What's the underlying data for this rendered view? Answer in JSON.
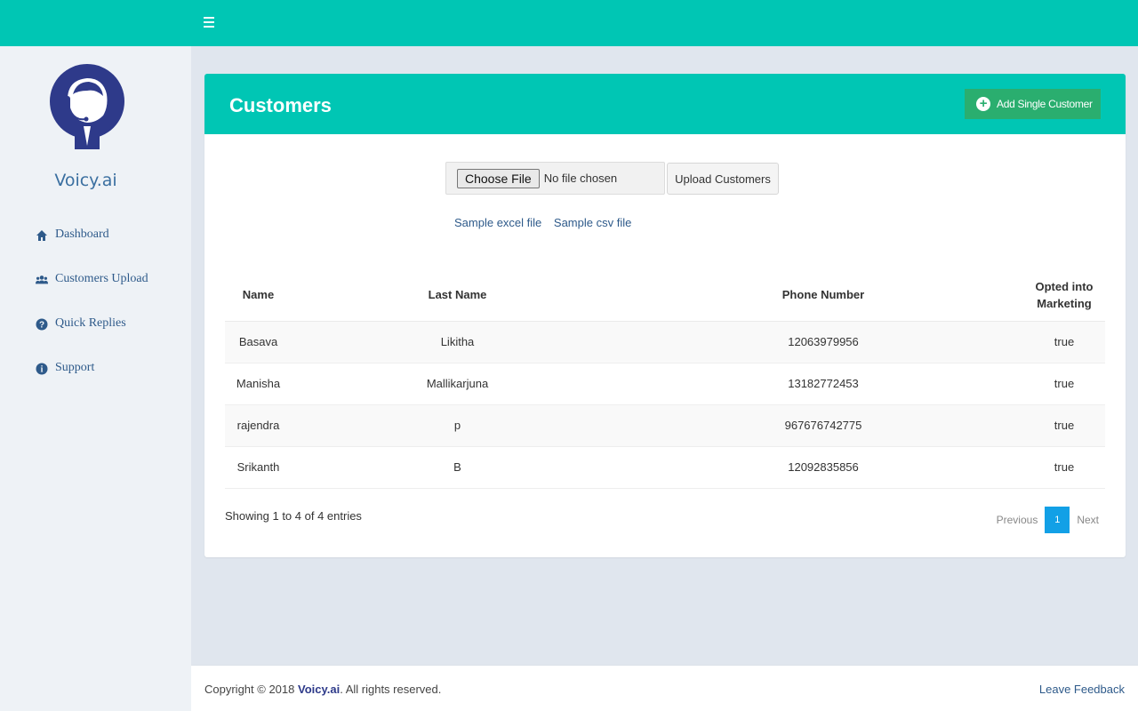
{
  "brand": {
    "name": "Voicy.ai"
  },
  "sidebar": {
    "items": [
      {
        "label": "Dashboard",
        "icon": "home-icon"
      },
      {
        "label": "Customers Upload",
        "icon": "users-icon"
      },
      {
        "label": "Quick Replies",
        "icon": "question-icon"
      },
      {
        "label": "Support",
        "icon": "info-icon"
      }
    ]
  },
  "card": {
    "title": "Customers",
    "add_label": "Add Single Customer"
  },
  "upload": {
    "choose_label": "Choose File",
    "no_file": "No file chosen",
    "upload_label": "Upload Customers",
    "sample_excel": "Sample excel file",
    "sample_csv": "Sample csv file"
  },
  "table": {
    "headers": [
      "Name",
      "Last Name",
      "Phone Number",
      "Opted into Marketing"
    ],
    "rows": [
      [
        "Basava",
        "Likitha",
        "12063979956",
        "true"
      ],
      [
        "Manisha",
        "Mallikarjuna",
        "13182772453",
        "true"
      ],
      [
        "rajendra",
        "p",
        "967676742775",
        "true"
      ],
      [
        "Srikanth",
        "B",
        "12092835856",
        "true"
      ]
    ]
  },
  "pagination": {
    "info": "Showing 1 to 4 of 4 entries",
    "previous": "Previous",
    "current": "1",
    "next": "Next"
  },
  "footer": {
    "copyright_prefix": "Copyright © 2018 ",
    "brand": "Voicy.ai",
    "copyright_suffix": ". All rights reserved.",
    "feedback": "Leave Feedback"
  },
  "colors": {
    "primary": "#00c6b4",
    "success": "#2aae6f",
    "pager_active": "#12a0e6",
    "logo": "#2e3a8a"
  }
}
